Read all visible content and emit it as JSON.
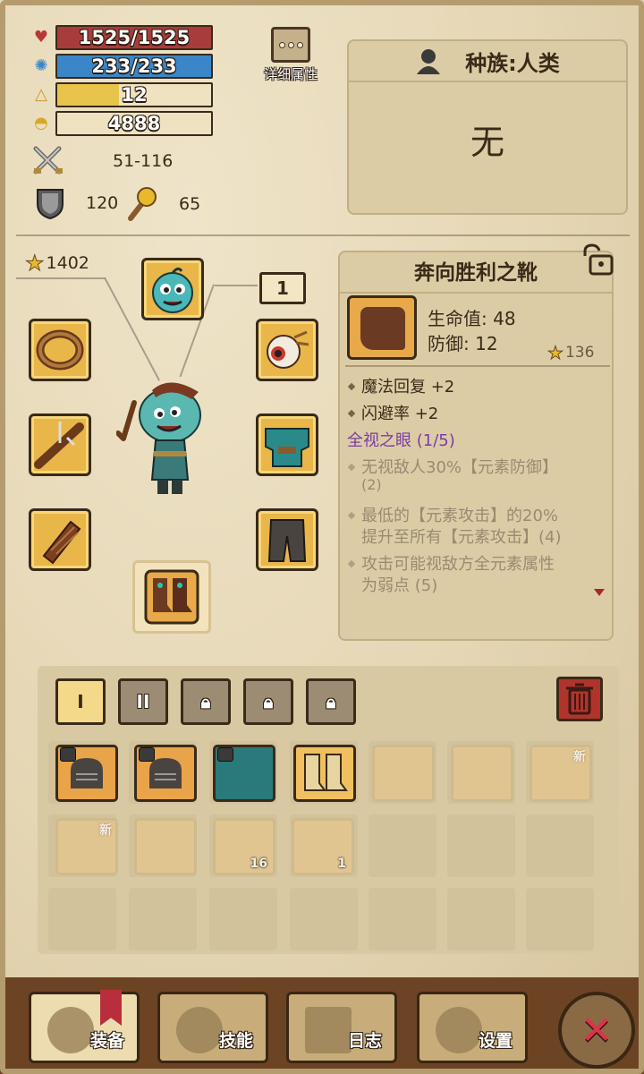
{
  "stats": {
    "hp": {
      "text": "1525/1525",
      "icon": "heart-icon",
      "color": "#b24040",
      "fraction": 1.0
    },
    "mp": {
      "text": "233/233",
      "icon": "gear-icon",
      "color": "#3a86c8",
      "fraction": 1.0
    },
    "level": {
      "text": "12",
      "icon": "triangle-icon",
      "color": "#e8c44c",
      "fraction": 0.4
    },
    "gold": {
      "text": "4888",
      "icon": "coins-icon",
      "color": "#efe2c0",
      "fraction": 0.0
    }
  },
  "detail_button_label": "详细属性",
  "attack": {
    "value": "51-116",
    "icon": "crossed-swords-icon"
  },
  "defense": {
    "value": "120",
    "icon": "shield-icon"
  },
  "magic": {
    "value": "65",
    "icon": "wand-icon"
  },
  "race": {
    "label": "种族:人类",
    "value": "无"
  },
  "equipment": {
    "star_total": "1402",
    "level_tag": "1"
  },
  "item_detail": {
    "name": "奔向胜利之靴",
    "stats": [
      "生命值: 48",
      "防御: 12"
    ],
    "star": "136",
    "bonuses": [
      "魔法回复 +2",
      "闪避率 +2"
    ],
    "set_name": "全视之眼 (1/5)",
    "set_bonuses": [
      {
        "line1": "无视敌人30%【元素防御】",
        "line2": "(2)"
      },
      {
        "line1": "最低的【元素攻击】的20%",
        "line2": "提升至所有【元素攻击】(4)"
      },
      {
        "line1": "攻击可能视敌方全元素属性",
        "line2": "为弱点 (5)"
      }
    ]
  },
  "inventory": {
    "tabs": [
      "I",
      "II",
      "",
      "",
      ""
    ],
    "items_row1": [
      {
        "name": "armor-item",
        "locked": true
      },
      {
        "name": "armor-item",
        "locked": true
      },
      {
        "name": "chest-armor-item",
        "locked": true
      },
      {
        "name": "boots-item"
      },
      {
        "name": "balloon-item",
        "ghost": true
      },
      {
        "name": "fur-item",
        "ghost": true
      },
      {
        "name": "fur-item",
        "ghost": true,
        "new": "新"
      }
    ],
    "items_row2": [
      {
        "name": "fur-item",
        "ghost": true,
        "new": "新"
      },
      {
        "name": "fur-item",
        "ghost": true
      },
      {
        "name": "scroll-box-item",
        "ghost": true,
        "count": "16"
      },
      {
        "name": "wing-item",
        "ghost": true,
        "count": "1"
      }
    ]
  },
  "nav": {
    "equip": "装备",
    "skills": "技能",
    "log": "日志",
    "settings": "设置"
  }
}
